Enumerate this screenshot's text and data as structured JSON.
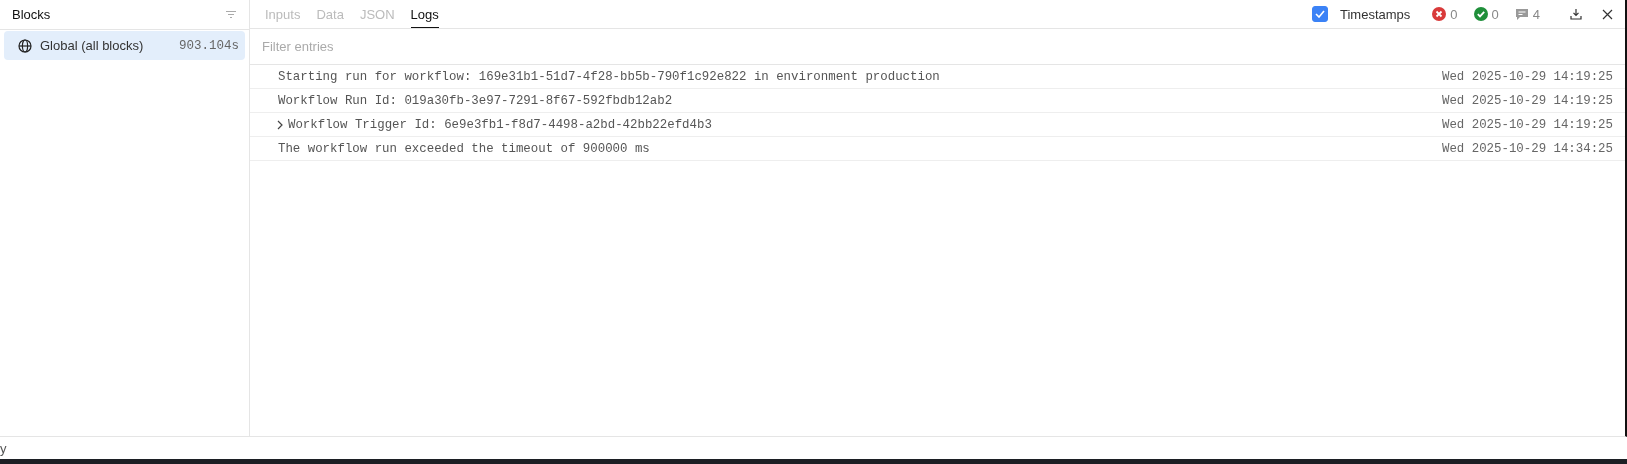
{
  "sidebar": {
    "title": "Blocks",
    "items": [
      {
        "label": "Global (all blocks)",
        "duration": "903.104s",
        "selected": true
      }
    ]
  },
  "tabs": [
    {
      "label": "Inputs",
      "selected": false
    },
    {
      "label": "Data",
      "selected": false
    },
    {
      "label": "JSON",
      "selected": false
    },
    {
      "label": "Logs",
      "selected": true
    }
  ],
  "timestamps": {
    "label": "Timestamps",
    "checked": true
  },
  "counters": [
    {
      "kind": "error",
      "count": "0"
    },
    {
      "kind": "success",
      "count": "0"
    },
    {
      "kind": "message",
      "count": "4"
    }
  ],
  "filter": {
    "placeholder": "Filter entries"
  },
  "entries": [
    {
      "message": "Starting run for workflow: 169e31b1-51d7-4f28-bb5b-790f1c92e822 in environment production",
      "time": "Wed 2025-10-29 14:19:25",
      "expandable": false
    },
    {
      "message": "Workflow Run Id: 019a30fb-3e97-7291-8f67-592fbdb12ab2",
      "time": "Wed 2025-10-29 14:19:25",
      "expandable": false
    },
    {
      "message": "Workflow Trigger Id: 6e9e3fb1-f8d7-4498-a2bd-42bb22efd4b3",
      "time": "Wed 2025-10-29 14:19:25",
      "expandable": true
    },
    {
      "message": "The workflow run exceeded the timeout of 900000 ms",
      "time": "Wed 2025-10-29 14:34:25",
      "expandable": false
    }
  ],
  "footer": {
    "text": "y"
  }
}
